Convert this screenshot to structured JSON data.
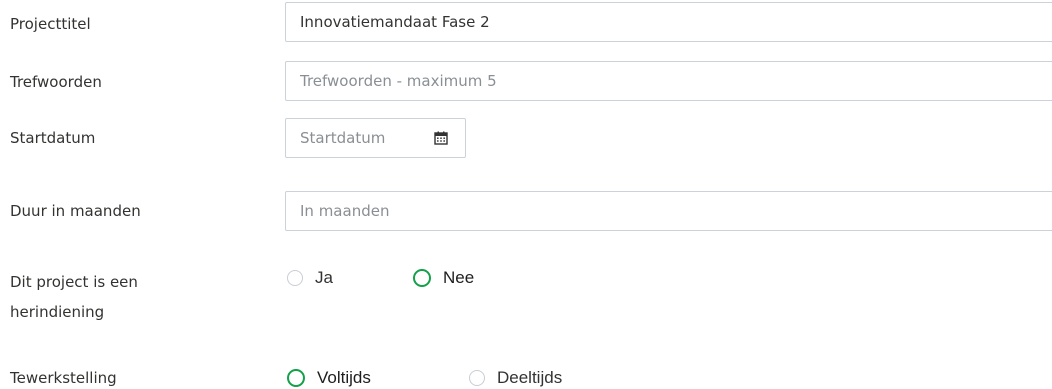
{
  "fields": {
    "project_title": {
      "label": "Projecttitel",
      "value": "Innovatiemandaat Fase 2"
    },
    "keywords": {
      "label": "Trefwoorden",
      "placeholder": "Trefwoorden - maximum 5"
    },
    "start_date": {
      "label": "Startdatum",
      "placeholder": "Startdatum",
      "icon": "calendar-icon"
    },
    "duration": {
      "label": "Duur in maanden",
      "placeholder": "In maanden"
    },
    "resubmission": {
      "label_line1": "Dit project is een",
      "label_line2": "herindiening",
      "options": [
        "Ja",
        "Nee"
      ],
      "selected": "Nee"
    },
    "employment": {
      "label": "Tewerkstelling",
      "options": [
        "Voltijds",
        "Deeltijds"
      ],
      "selected": "Voltijds"
    }
  },
  "colors": {
    "accent_green": "#15a04a",
    "border": "#cbd2da",
    "placeholder": "#8a8f94",
    "text": "#333332"
  }
}
